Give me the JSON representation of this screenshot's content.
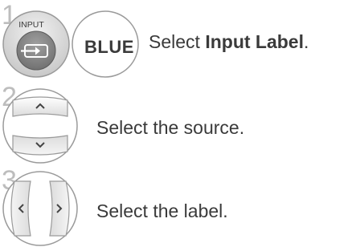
{
  "steps": [
    {
      "number": "1",
      "input_button_label": "INPUT",
      "color_button_label": "BLUE",
      "instruction_prefix": "Select ",
      "instruction_bold": "Input Label",
      "instruction_suffix": "."
    },
    {
      "number": "2",
      "instruction": "Select the source."
    },
    {
      "number": "3",
      "instruction": "Select the label."
    }
  ],
  "icons": {
    "input": "input-source-icon",
    "up": "chevron-up-icon",
    "down": "chevron-down-icon",
    "left": "chevron-left-icon",
    "right": "chevron-right-icon"
  },
  "colors": {
    "button_fill": "#8a8a8a",
    "button_ring": "#d0d0d0",
    "step_number": "#bdbdbd",
    "text": "#3a3a3a"
  }
}
